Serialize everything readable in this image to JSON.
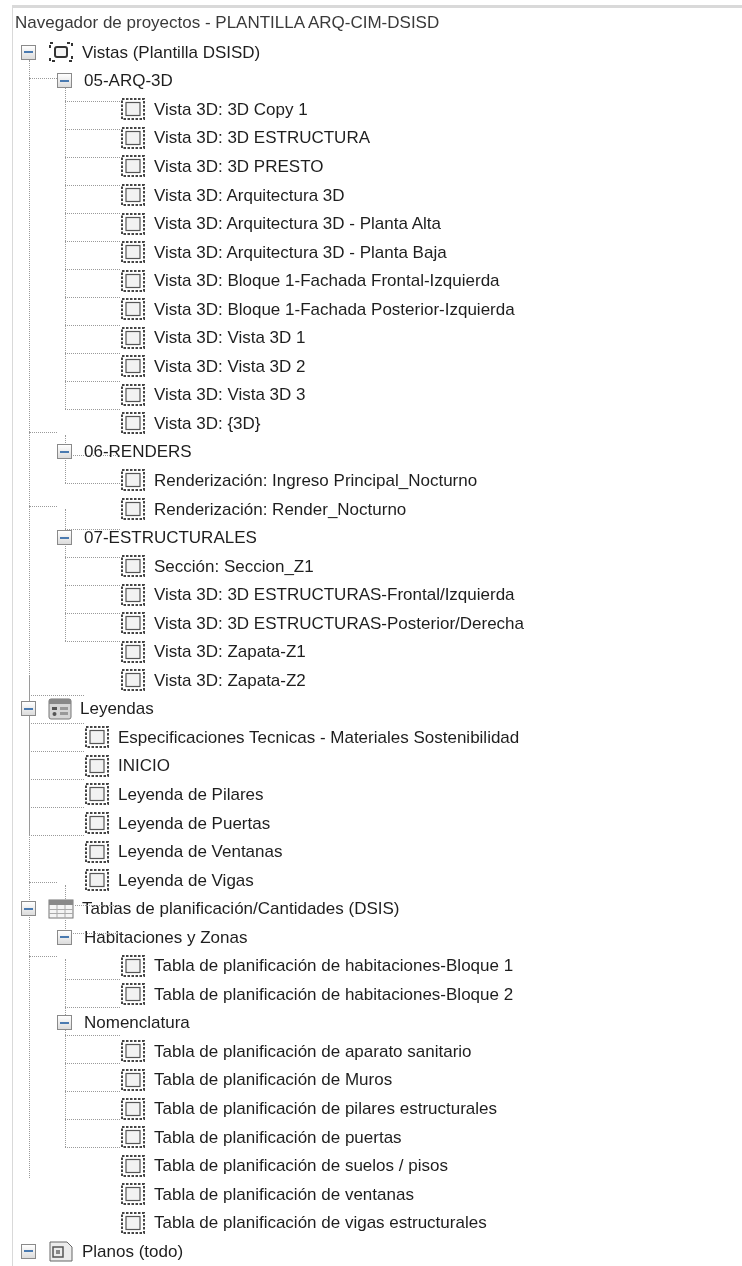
{
  "panel": {
    "title": "Navegador de proyectos - PLANTILLA ARQ-CIM-DSISD"
  },
  "tree": [
    {
      "label": "Vistas (Plantilla DSISD)",
      "kind": "views",
      "expanded": true,
      "children": [
        {
          "label": "05-ARQ-3D",
          "expanded": true,
          "children": [
            {
              "label": "Vista 3D: 3D Copy 1"
            },
            {
              "label": "Vista 3D: 3D ESTRUCTURA"
            },
            {
              "label": "Vista 3D: 3D PRESTO"
            },
            {
              "label": "Vista 3D: Arquitectura 3D"
            },
            {
              "label": "Vista 3D: Arquitectura 3D - Planta Alta"
            },
            {
              "label": "Vista 3D: Arquitectura 3D - Planta Baja"
            },
            {
              "label": "Vista 3D: Bloque 1-Fachada Frontal-Izquierda"
            },
            {
              "label": "Vista 3D: Bloque 1-Fachada Posterior-Izquierda"
            },
            {
              "label": "Vista 3D: Vista 3D 1"
            },
            {
              "label": "Vista 3D: Vista 3D 2"
            },
            {
              "label": "Vista 3D: Vista 3D 3"
            },
            {
              "label": "Vista 3D: {3D}"
            }
          ]
        },
        {
          "label": "06-RENDERS",
          "expanded": true,
          "children": [
            {
              "label": "Renderización: Ingreso Principal_Nocturno"
            },
            {
              "label": "Renderización: Render_Nocturno"
            }
          ]
        },
        {
          "label": "07-ESTRUCTURALES",
          "expanded": true,
          "children": [
            {
              "label": "Sección: Seccion_Z1"
            },
            {
              "label": "Vista 3D: 3D ESTRUCTURAS-Frontal/Izquierda"
            },
            {
              "label": "Vista 3D: 3D ESTRUCTURAS-Posterior/Derecha"
            },
            {
              "label": "Vista 3D: Zapata-Z1"
            },
            {
              "label": "Vista 3D: Zapata-Z2"
            }
          ]
        }
      ]
    },
    {
      "label": "Leyendas",
      "kind": "legend",
      "expanded": true,
      "children": [
        {
          "label": "Especificaciones Tecnicas - Materiales Sostenibilidad"
        },
        {
          "label": "INICIO"
        },
        {
          "label": "Leyenda de Pilares"
        },
        {
          "label": "Leyenda de Puertas"
        },
        {
          "label": "Leyenda de Ventanas"
        },
        {
          "label": "Leyenda de Vigas"
        }
      ]
    },
    {
      "label": "Tablas de planificación/Cantidades (DSIS)",
      "kind": "schedule",
      "expanded": true,
      "children": [
        {
          "label": "Habitaciones y Zonas",
          "expanded": true,
          "children": [
            {
              "label": "Tabla de planificación de habitaciones-Bloque 1"
            },
            {
              "label": "Tabla de planificación de habitaciones-Bloque 2"
            }
          ]
        },
        {
          "label": "Nomenclatura",
          "expanded": true,
          "children": [
            {
              "label": "Tabla de planificación de aparato sanitario"
            },
            {
              "label": "Tabla de planificación de Muros"
            },
            {
              "label": "Tabla de planificación de pilares estructurales"
            },
            {
              "label": "Tabla de planificación de puertas"
            },
            {
              "label": "Tabla de planificación de suelos / pisos"
            },
            {
              "label": "Tabla de planificación de ventanas"
            },
            {
              "label": "Tabla de planificación de vigas estructurales"
            }
          ]
        }
      ]
    },
    {
      "label": "Planos (todo)",
      "kind": "sheet",
      "expanded": true
    }
  ]
}
